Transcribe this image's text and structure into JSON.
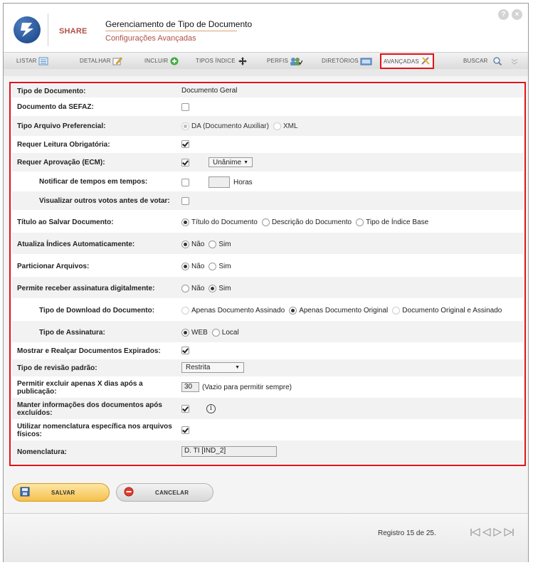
{
  "app": {
    "brand": "SHARE",
    "title": "Gerenciamento de Tipo de Documento",
    "subtitle": "Configurações Avançadas"
  },
  "window_buttons": {
    "help": "?",
    "close": "×"
  },
  "tabs": [
    {
      "label": "LISTAR",
      "icon": "list-icon"
    },
    {
      "label": "DETALHAR",
      "icon": "edit-icon"
    },
    {
      "label": "INCLUIR",
      "icon": "add-icon"
    },
    {
      "label": "TIPOS ÍNDICE",
      "icon": "move-icon"
    },
    {
      "label": "PERFIS",
      "icon": "users-icon"
    },
    {
      "label": "DIRETÓRIOS",
      "icon": "folder-icon"
    },
    {
      "label": "AVANÇADAS",
      "icon": "tools-icon",
      "active": true
    },
    {
      "label": "BUSCAR",
      "icon": "search-icon"
    }
  ],
  "form": {
    "tipo_documento": {
      "label": "Tipo de Documento:",
      "value": "Documento Geral"
    },
    "documento_sefaz": {
      "label": "Documento da SEFAZ:",
      "checked": false
    },
    "tipo_arquivo": {
      "label": "Tipo Arquivo Preferencial:",
      "options": [
        "DA (Documento Auxiliar)",
        "XML"
      ],
      "selected": "DA (Documento Auxiliar)"
    },
    "requer_leitura": {
      "label": "Requer Leitura Obrigatória:",
      "checked": true
    },
    "requer_aprovacao": {
      "label": "Requer Aprovação (ECM):",
      "checked": true,
      "select_value": "Unânime"
    },
    "notificar": {
      "label": "Notificar de tempos em tempos:",
      "checked": false,
      "hours_value": "",
      "hours_label": "Horas"
    },
    "visualizar_votos": {
      "label": "Visualizar outros votos antes de votar:",
      "checked": false
    },
    "titulo_salvar": {
      "label": "Título ao Salvar Documento:",
      "options": [
        "Título do Documento",
        "Descrição do Documento",
        "Tipo de Índice Base"
      ],
      "selected": "Título do Documento"
    },
    "atualiza_indices": {
      "label": "Atualiza Índices Automaticamente:",
      "options": [
        "Não",
        "Sim"
      ],
      "selected": "Não"
    },
    "particionar": {
      "label": "Particionar Arquivos:",
      "options": [
        "Não",
        "Sim"
      ],
      "selected": "Não"
    },
    "assinatura_digital": {
      "label": "Permite receber assinatura digitalmente:",
      "options": [
        "Não",
        "Sim"
      ],
      "selected": "Sim"
    },
    "tipo_download": {
      "label": "Tipo de Download do Documento:",
      "options": [
        "Apenas Documento Assinado",
        "Apenas Documento Original",
        "Documento Original e Assinado"
      ],
      "selected": "Apenas Documento Original"
    },
    "tipo_assinatura": {
      "label": "Tipo de Assinatura:",
      "options": [
        "WEB",
        "Local"
      ],
      "selected": "WEB"
    },
    "mostrar_expirados": {
      "label": "Mostrar e Realçar Documentos Expirados:",
      "checked": true
    },
    "tipo_revisao": {
      "label": "Tipo de revisão padrão:",
      "value": "Restrita"
    },
    "excluir_dias": {
      "label": "Permitir excluir apenas X dias após a publicação:",
      "value": "30",
      "hint": "(Vazio para permitir sempre)"
    },
    "manter_info": {
      "label": "Manter informações dos documentos após excluídos:",
      "checked": true,
      "info": "i"
    },
    "nomenclatura_especifica": {
      "label": "Utilizar nomenclatura específica nos arquivos físicos:",
      "checked": true
    },
    "nomenclatura": {
      "label": "Nomenclatura:",
      "value": "D. TI [IND_2]"
    }
  },
  "actions": {
    "save_label": "SALVAR",
    "cancel_label": "CANCELAR"
  },
  "footer": {
    "record_text": "Registro 15 de 25."
  },
  "colors": {
    "highlight_border": "#e0121b",
    "brand": "#b0504a",
    "save_button": "#f5c04a"
  }
}
